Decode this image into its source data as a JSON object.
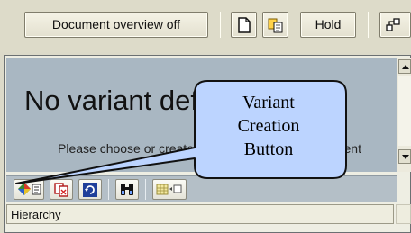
{
  "toolbar": {
    "document_overview_label": "Document overview off",
    "hold_label": "Hold",
    "icons": [
      "new-document-icon",
      "copy-document-icon",
      "tree-icon"
    ]
  },
  "content": {
    "message_title": "No variant defined",
    "message_body": "Please choose or create a variant to display document"
  },
  "sub_toolbar": {
    "icons": [
      "variant-creation-icon",
      "delete-variant-icon",
      "refresh-icon",
      "find-icon",
      "layout-icon"
    ]
  },
  "hierarchy": {
    "column_label": "Hierarchy"
  },
  "callout": {
    "line1": "Variant",
    "line2": "Creation",
    "line3": "Button"
  },
  "colors": {
    "content_background": "#a9b7c2",
    "callout_fill": "#bcd4ff",
    "toolbar_background": "#dddbc9"
  }
}
